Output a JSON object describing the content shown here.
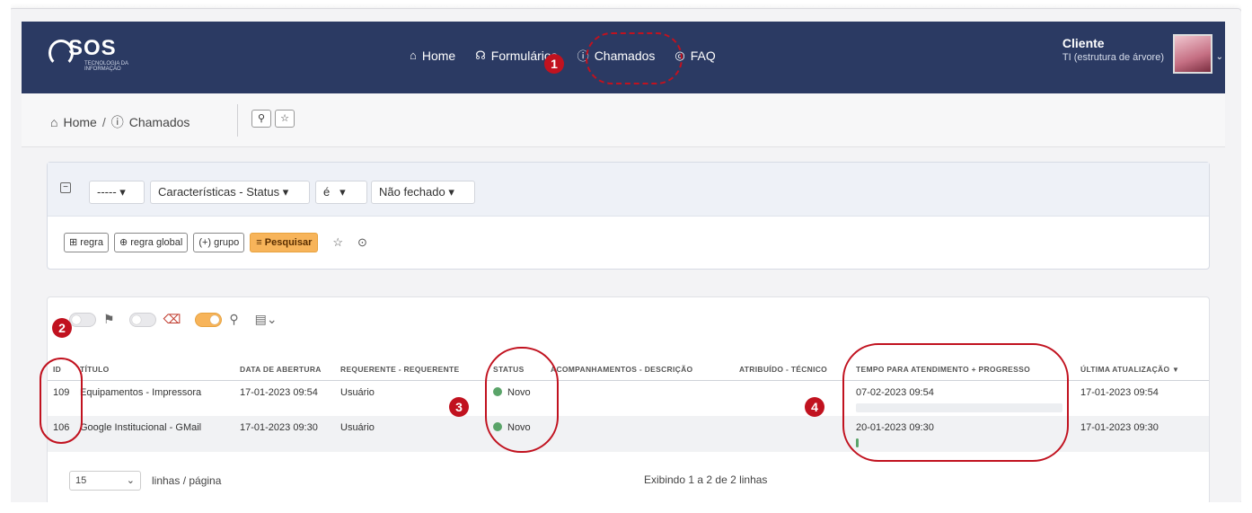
{
  "brand": {
    "logo_text": "SOS",
    "logo_sub": "TECNOLOGIA DA INFORMAÇÃO"
  },
  "nav": {
    "items": [
      {
        "label": "Home",
        "icon": "home-icon"
      },
      {
        "label": "Formulários",
        "icon": "headset-icon"
      },
      {
        "label": "Chamados",
        "icon": "alert-circle-icon"
      },
      {
        "label": "FAQ",
        "icon": "globe-icon"
      }
    ]
  },
  "user": {
    "name": "Cliente",
    "entity": "TI (estrutura de árvore)"
  },
  "breadcrumb": {
    "home": "Home",
    "sep": "/",
    "current": "Chamados"
  },
  "search": {
    "criteria": [
      "-----",
      "Características - Status",
      "é",
      "Não fechado"
    ],
    "buttons": {
      "rule": "regra",
      "global_rule": "regra global",
      "group": "grupo",
      "search": "Pesquisar"
    }
  },
  "table": {
    "columns": [
      "ID",
      "TÍTULO",
      "DATA DE ABERTURA",
      "REQUERENTE - REQUERENTE",
      "STATUS",
      "ACOMPANHAMENTOS - DESCRIÇÃO",
      "ATRIBUÍDO - TÉCNICO",
      "TEMPO PARA ATENDIMENTO + PROGRESSO",
      "ÚLTIMA ATUALIZAÇÃO"
    ],
    "rows": [
      {
        "id": "109",
        "title": "Equipamentos - Impressora",
        "opened": "17-01-2023 09:54",
        "requester": "Usuário",
        "status": "Novo",
        "followups": "",
        "tech": "",
        "due": "07-02-2023 09:54",
        "progress": 0.0,
        "updated": "17-01-2023 09:54"
      },
      {
        "id": "106",
        "title": "Google Institucional - GMail",
        "opened": "17-01-2023 09:30",
        "requester": "Usuário",
        "status": "Novo",
        "followups": "",
        "tech": "",
        "due": "20-01-2023 09:30",
        "progress": 0.01,
        "updated": "17-01-2023 09:30"
      }
    ]
  },
  "footer": {
    "page_size": "15",
    "rows_label": "linhas / página",
    "showing": "Exibindo 1 a 2 de 2 linhas"
  },
  "annotations": [
    "1",
    "2",
    "3",
    "4"
  ],
  "colors": {
    "navbar": "#2b3a63",
    "accent": "#f7b45a",
    "status_new": "#5aa469",
    "annotation": "#c1121f"
  }
}
